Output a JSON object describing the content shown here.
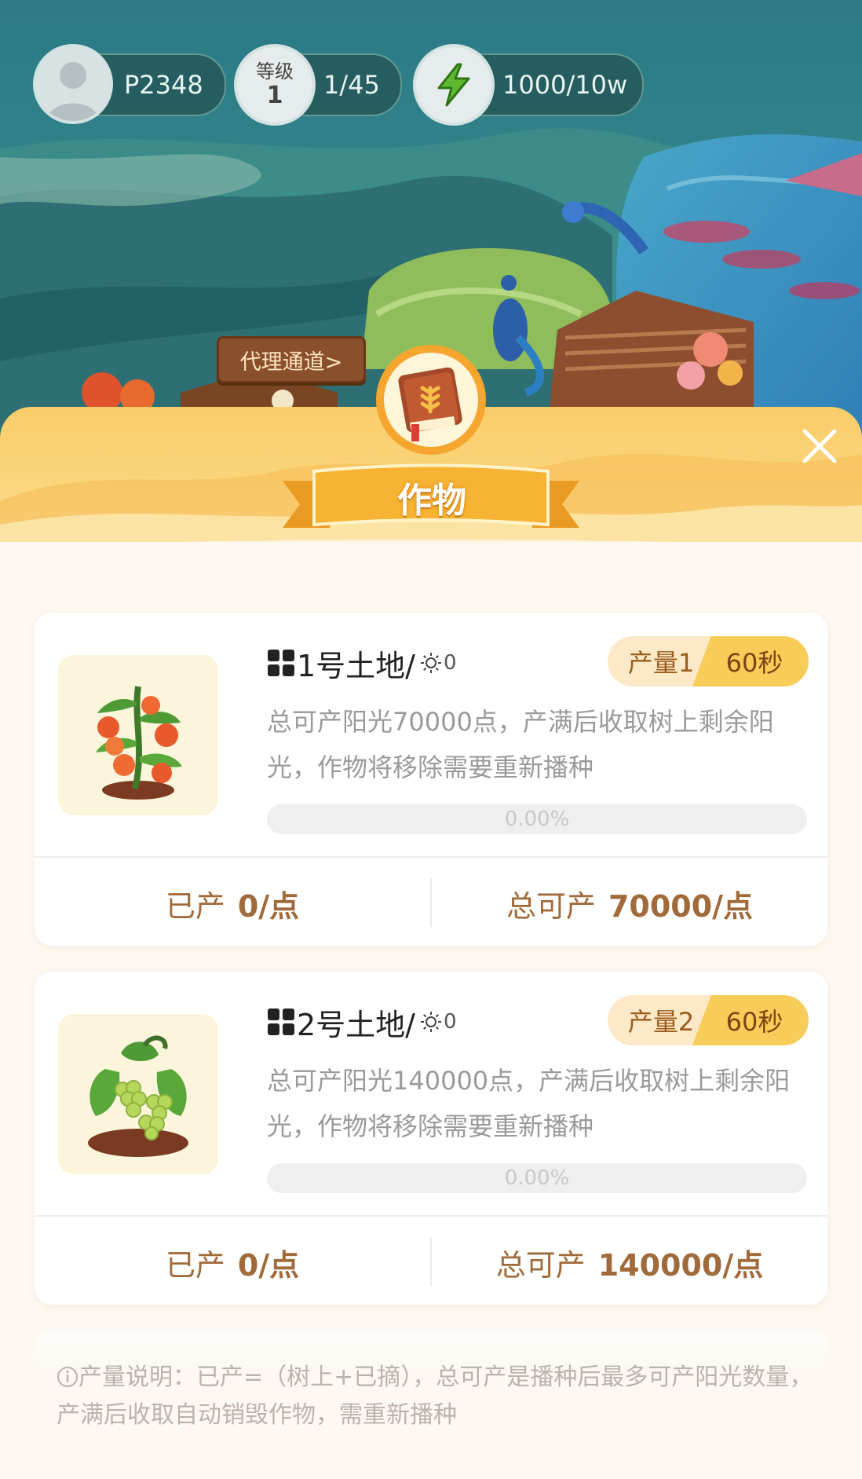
{
  "topbar": {
    "user_id": "P2348",
    "level_label": "等级",
    "level_value": "1",
    "level_progress": "1/45",
    "energy": "1000/10w"
  },
  "agent_channel": "代理通道>",
  "modal": {
    "title": "作物"
  },
  "plots": [
    {
      "name": "1号土地/",
      "sun_count": "0",
      "yield_label": "产量1",
      "time_label": "60秒",
      "description": "总可产阳光70000点，产满后收取树上剩余阳光，作物将移除需要重新播种",
      "progress_text": "0.00%",
      "progress_fraction": 0,
      "produced_label": "已产",
      "produced_value": "0/点",
      "total_label": "总可产",
      "total_value": "70000/点",
      "crop_icon": "tomato-plant-icon"
    },
    {
      "name": "2号土地/",
      "sun_count": "0",
      "yield_label": "产量2",
      "time_label": "60秒",
      "description": "总可产阳光140000点，产满后收取树上剩余阳光，作物将移除需要重新播种",
      "progress_text": "0.00%",
      "progress_fraction": 0,
      "produced_label": "已产",
      "produced_value": "0/点",
      "total_label": "总可产",
      "total_value": "140000/点",
      "crop_icon": "grape-vine-icon"
    }
  ],
  "footnote": "产量说明：已产=（树上+已摘），总可产是播种后最多可产阳光数量，产满后收取自动销毁作物，需重新播种",
  "colors": {
    "accent_orange": "#f8cc58",
    "stat_brown": "#a16a3a",
    "teal_bg": "#2f7f86"
  }
}
